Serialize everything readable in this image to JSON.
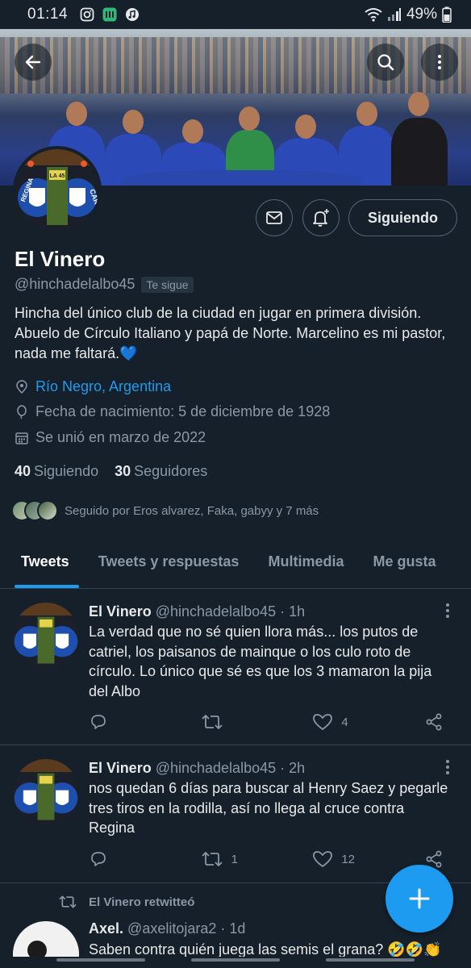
{
  "status_bar": {
    "time": "01:14",
    "battery": "49%"
  },
  "profile": {
    "name": "El Vinero",
    "handle": "@hinchadelalbo45",
    "follows_you": "Te sigue",
    "follow_button": "Siguiendo",
    "bio": "Hincha del único club de la ciudad en jugar en primera división. Abuelo de Círculo Italiano y papá de Norte. Marcelino es mi pastor, nada me faltará.💙",
    "location": "Río Negro, Argentina",
    "birthday": "Fecha de nacimiento: 5 de diciembre de 1928",
    "joined": "Se unió en marzo de 2022",
    "following_count": "40",
    "following_label": "Siguiendo",
    "followers_count": "30",
    "followers_label": "Seguidores",
    "followed_by": "Seguido por Eros alvarez, Faka, gabyy y 7 más",
    "avatar_text_left": "REGINA",
    "avatar_text_right": "CAR",
    "avatar_badge": "LA 45"
  },
  "tabs": [
    {
      "label": "Tweets"
    },
    {
      "label": "Tweets y respuestas"
    },
    {
      "label": "Multimedia"
    },
    {
      "label": "Me gusta"
    }
  ],
  "tweets": [
    {
      "name": "El Vinero",
      "handle": "@hinchadelalbo45",
      "time": "1h",
      "text": "La verdad que no sé quien llora más... los putos de catriel, los paisanos de mainque o los culo roto de círculo. Lo único que sé es que los 3 mamaron la pija del Albo",
      "retweets": "",
      "likes": "4"
    },
    {
      "name": "El Vinero",
      "handle": "@hinchadelalbo45",
      "time": "2h",
      "text": "nos quedan 6 días para buscar al Henry Saez y pegarle tres tiros en la rodilla, así no llega al cruce contra Regina",
      "retweets": "1",
      "likes": "12"
    },
    {
      "retweeted_by": "El Vinero retwitteó",
      "name": "Axel.",
      "handle": "@axelitojara2",
      "time": "1d",
      "text": "Saben contra quién juega las semis el grana? 🤣🤣👏"
    }
  ],
  "colors": {
    "background": "#15202b",
    "accent": "#1d9bf0",
    "muted": "#8b98a5",
    "border": "#38444d"
  },
  "icons": {
    "back": "arrow-left-icon",
    "search": "search-icon",
    "more": "more-vertical-icon",
    "message": "mail-icon",
    "notify": "bell-plus-icon",
    "location": "location-pin-icon",
    "birthday": "balloon-icon",
    "joined": "calendar-icon",
    "reply": "reply-icon",
    "retweet": "retweet-icon",
    "like": "heart-icon",
    "share": "share-icon",
    "compose": "plus-icon"
  }
}
